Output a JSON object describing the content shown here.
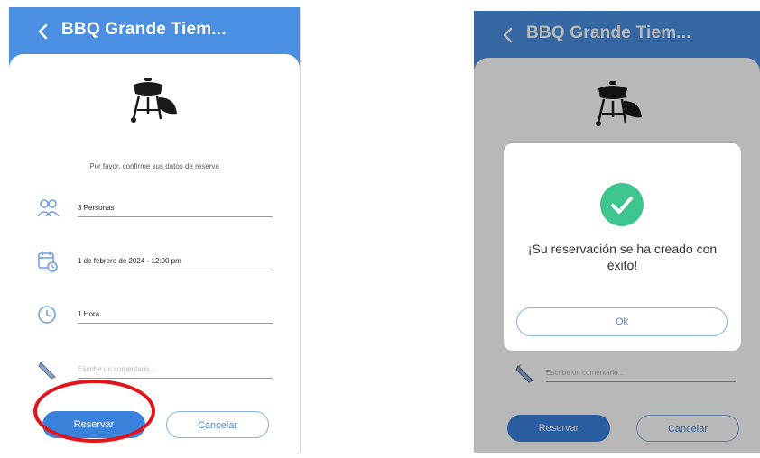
{
  "left_screen": {
    "header": {
      "title": "BBQ Grande Tiem...",
      "back_icon": "chevron-left-icon"
    },
    "prompt": "Por favor, confirme sus datos de reserva",
    "fields": {
      "guests": {
        "icon": "people-icon",
        "value": "3 Personas"
      },
      "datetime": {
        "icon": "calendar-clock-icon",
        "value": "1 de febrero de 2024 - 12:00 pm"
      },
      "duration": {
        "icon": "clock-icon",
        "value": "1 Hora"
      },
      "comment": {
        "icon": "pencil-icon",
        "placeholder": "Escribe un comentario..."
      }
    },
    "buttons": {
      "reserve": "Reservar",
      "cancel": "Cancelar"
    },
    "annotation": {
      "highlight_color": "#e2141c",
      "highlights": "reserve-button"
    }
  },
  "right_screen": {
    "header": {
      "title": "BBQ Grande Tiem...",
      "back_icon": "chevron-left-icon"
    },
    "comment_placeholder": "Escribe un comentario...",
    "buttons": {
      "reserve": "Reservar",
      "cancel": "Cancelar"
    },
    "modal": {
      "icon": "check-circle-icon",
      "message": "¡Su reservación se ha creado con éxito!",
      "ok_label": "Ok"
    }
  },
  "colors": {
    "accent": "#4a8fe2",
    "primary_button": "#3b82dd",
    "success": "#3ec48f"
  }
}
